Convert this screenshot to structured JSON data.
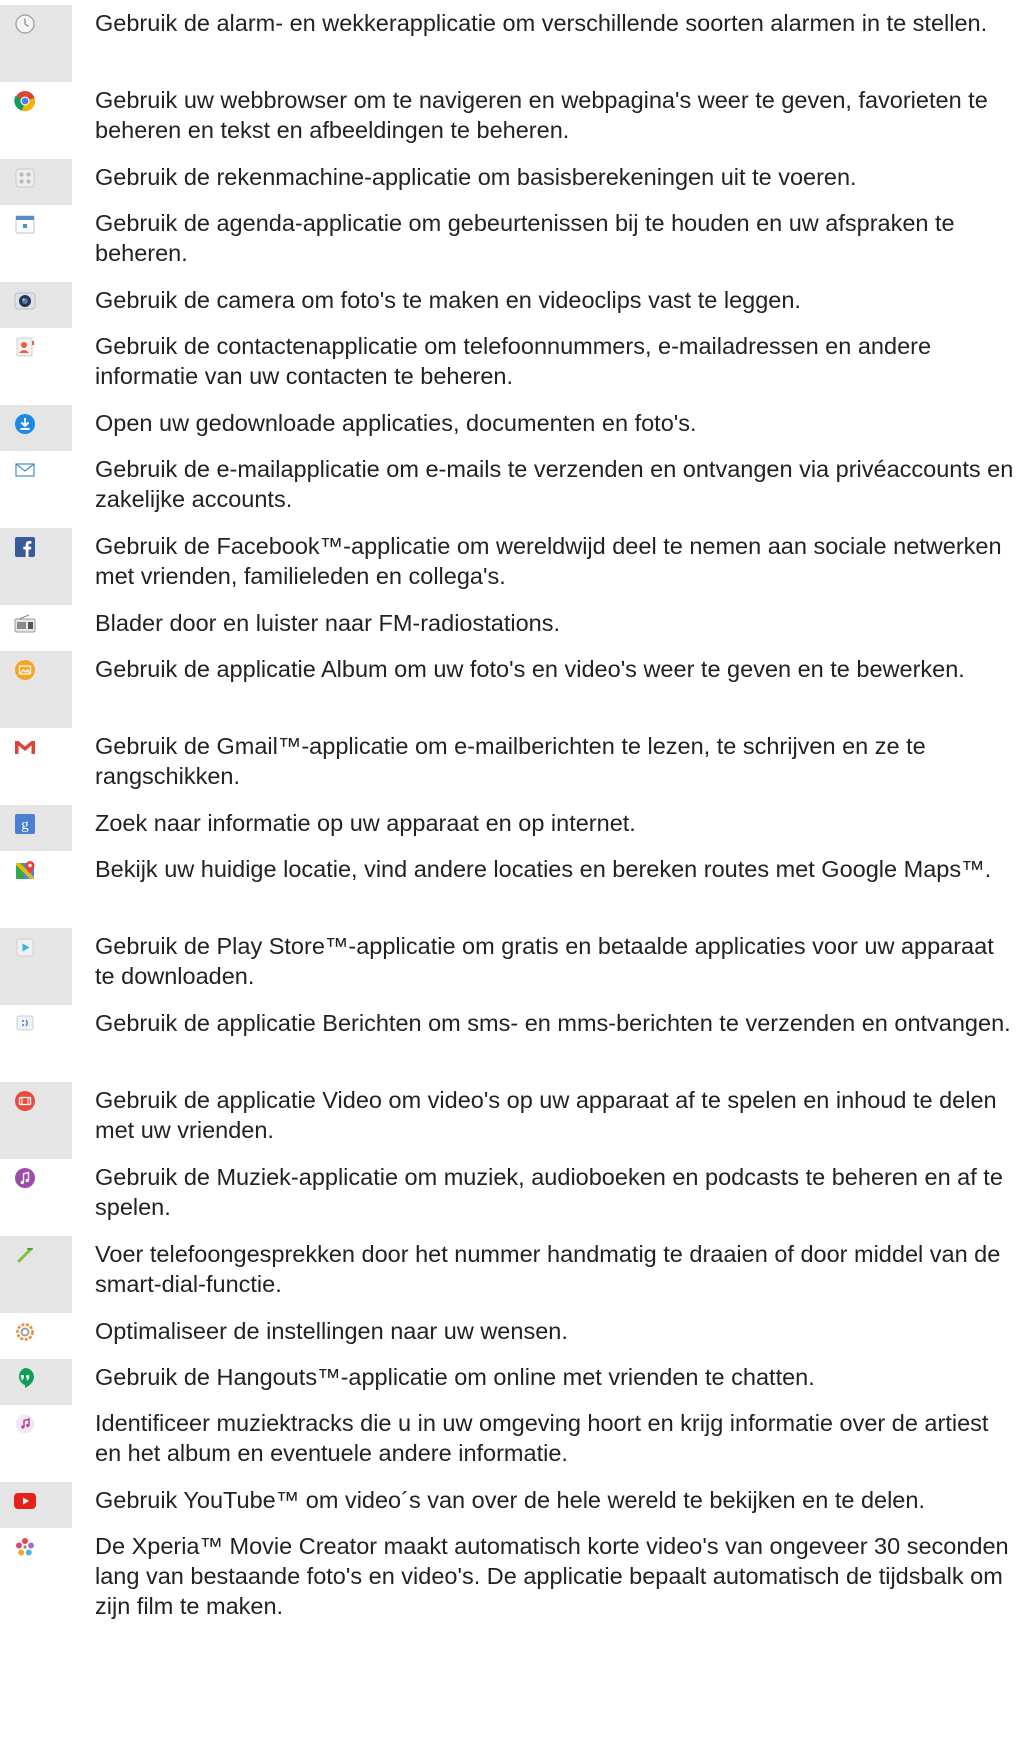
{
  "items": [
    {
      "icon": "alarm-clock-icon",
      "text": "Gebruik de alarm- en wekkerapplicatie om verschillende soorten alarmen in te stellen."
    },
    {
      "icon": "chrome-browser-icon",
      "text": "Gebruik uw webbrowser om te navigeren en webpagina's weer te geven, favorieten te beheren en tekst en afbeeldingen te beheren."
    },
    {
      "icon": "calculator-icon",
      "text": "Gebruik de rekenmachine-applicatie om basisberekeningen uit te voeren."
    },
    {
      "icon": "calendar-icon",
      "text": "Gebruik de agenda-applicatie om gebeurtenissen bij te houden en uw afspraken te beheren."
    },
    {
      "icon": "camera-icon",
      "text": "Gebruik de camera om foto's te maken en videoclips vast te leggen."
    },
    {
      "icon": "contacts-icon",
      "text": "Gebruik de contactenapplicatie om telefoonnummers, e-mailadressen en andere informatie van uw contacten te beheren."
    },
    {
      "icon": "download-icon",
      "text": "Open uw gedownloade applicaties, documenten en foto's."
    },
    {
      "icon": "email-icon",
      "text": "Gebruik de e-mailapplicatie om e-mails te verzenden en ontvangen via privéaccounts en zakelijke accounts."
    },
    {
      "icon": "facebook-icon",
      "text": "Gebruik de Facebook™-applicatie om wereldwijd deel te nemen aan sociale netwerken met vrienden, familieleden en collega's."
    },
    {
      "icon": "fm-radio-icon",
      "text": "Blader door en luister naar FM-radiostations."
    },
    {
      "icon": "album-icon",
      "text": "Gebruik de applicatie Album om uw foto's en video's weer te geven en te bewerken."
    },
    {
      "icon": "gmail-icon",
      "text": "Gebruik de Gmail™-applicatie om e-mailberichten te lezen, te schrijven en ze te rangschikken."
    },
    {
      "icon": "google-search-icon",
      "text": "Zoek naar informatie op uw apparaat en op internet."
    },
    {
      "icon": "maps-icon",
      "text": "Bekijk uw huidige locatie, vind andere locaties en bereken routes met Google Maps™."
    },
    {
      "icon": "play-store-icon",
      "text": "Gebruik de Play Store™-applicatie om gratis en betaalde applicaties voor uw apparaat te downloaden."
    },
    {
      "icon": "messaging-icon",
      "text": "Gebruik de applicatie Berichten om sms- en mms-berichten te verzenden en ontvangen."
    },
    {
      "icon": "video-icon",
      "text": "Gebruik de applicatie Video om video's op uw apparaat af te spelen en inhoud te delen met uw vrienden."
    },
    {
      "icon": "music-icon",
      "text": "Gebruik de Muziek-applicatie om muziek, audioboeken en podcasts te beheren en af te spelen."
    },
    {
      "icon": "phone-icon",
      "text": "Voer telefoongesprekken door het nummer handmatig te draaien of door middel van de smart-dial-functie."
    },
    {
      "icon": "settings-icon",
      "text": "Optimaliseer de instellingen naar uw wensen."
    },
    {
      "icon": "hangouts-icon",
      "text": "Gebruik de Hangouts™-applicatie om online met vrienden te chatten."
    },
    {
      "icon": "music-identify-icon",
      "text": "Identificeer muziektracks die u in uw omgeving hoort en krijg informatie over de artiest en het album en eventuele andere informatie."
    },
    {
      "icon": "youtube-icon",
      "text": "Gebruik YouTube™ om video´s van over de hele wereld te bekijken en te delen."
    },
    {
      "icon": "movie-creator-icon",
      "text": "De Xperia™ Movie Creator maakt automatisch korte video's van ongeveer 30 seconden lang van bestaande foto's en video's. De applicatie bepaalt automatisch de tijdsbalk om zijn film te maken."
    }
  ]
}
